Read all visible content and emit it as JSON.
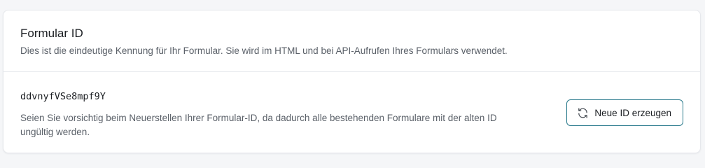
{
  "card": {
    "title": "Formular ID",
    "description": "Dies ist die eindeutige Kennung für Ihr Formular. Sie wird im HTML und bei API-Aufrufen Ihres Formulars verwendet.",
    "form_id": "ddvnyfVSe8mpf9Y",
    "warning": "Seien Sie vorsichtig beim Neuerstellen Ihrer Formular-ID, da dadurch alle bestehenden Formulare mit der alten ID ungültig werden.",
    "regenerate_button": {
      "label": "Neue ID erzeugen",
      "icon": "refresh-icon"
    }
  },
  "colors": {
    "button_border": "#2a7a8c",
    "text_primary": "#1a1d21",
    "text_secondary": "#5b6169",
    "divider": "#e6e8ec"
  }
}
